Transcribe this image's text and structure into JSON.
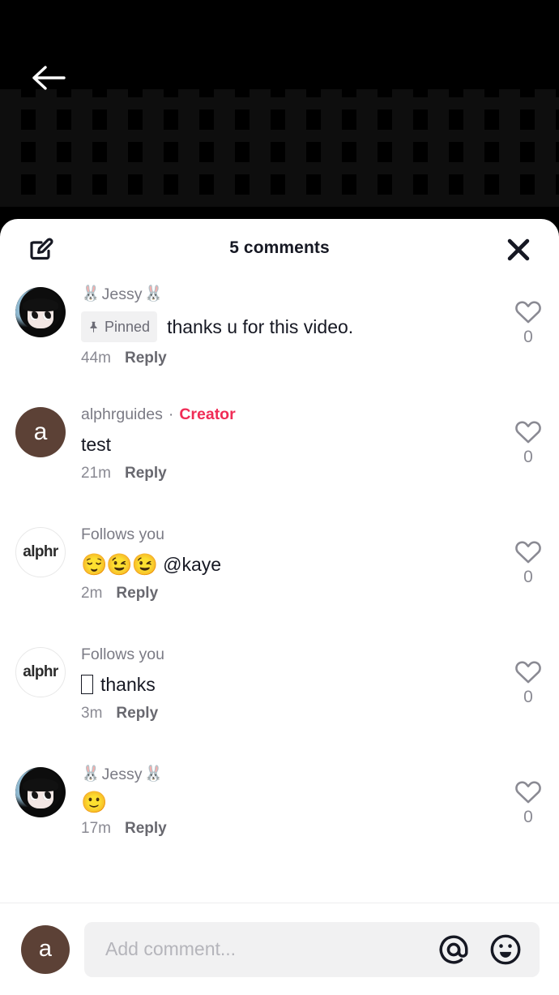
{
  "video": {
    "back_icon": "back-arrow-icon"
  },
  "header": {
    "title": "5 comments",
    "compose_icon": "compose-icon",
    "close_icon": "close-icon"
  },
  "comments": [
    {
      "avatar_type": "anime",
      "avatar_label": "",
      "name_prefix_emoji": "🐰",
      "name": "Jessy",
      "name_suffix_emoji": "🐰",
      "badge": "",
      "pinned_label": "Pinned",
      "is_pinned": true,
      "text": "thanks u for this video.",
      "emoji_prefix": "",
      "has_tofu": false,
      "time": "44m",
      "reply_label": "Reply",
      "likes": "0"
    },
    {
      "avatar_type": "brown",
      "avatar_label": "a",
      "name_prefix_emoji": "",
      "name": "alphrguides",
      "name_suffix_emoji": "",
      "badge": "Creator",
      "pinned_label": "",
      "is_pinned": false,
      "text": "test",
      "emoji_prefix": "",
      "has_tofu": false,
      "time": "21m",
      "reply_label": "Reply",
      "likes": "0"
    },
    {
      "avatar_type": "logo",
      "avatar_label": "alphr",
      "name_prefix_emoji": "",
      "name": "Follows you",
      "name_suffix_emoji": "",
      "badge": "",
      "pinned_label": "",
      "is_pinned": false,
      "text": "@kaye",
      "emoji_prefix": "😌😉😉",
      "has_tofu": false,
      "time": "2m",
      "reply_label": "Reply",
      "likes": "0"
    },
    {
      "avatar_type": "logo",
      "avatar_label": "alphr",
      "name_prefix_emoji": "",
      "name": "Follows you",
      "name_suffix_emoji": "",
      "badge": "",
      "pinned_label": "",
      "is_pinned": false,
      "text": "thanks",
      "emoji_prefix": "",
      "has_tofu": true,
      "time": "3m",
      "reply_label": "Reply",
      "likes": "0"
    },
    {
      "avatar_type": "anime",
      "avatar_label": "",
      "name_prefix_emoji": "🐰",
      "name": "Jessy",
      "name_suffix_emoji": "🐰",
      "badge": "",
      "pinned_label": "",
      "is_pinned": false,
      "text": "",
      "emoji_prefix": "🙂",
      "has_tofu": false,
      "time": "17m",
      "reply_label": "Reply",
      "likes": "0"
    }
  ],
  "composer": {
    "avatar_label": "a",
    "placeholder": "Add comment...",
    "mention_icon": "at-mention-icon",
    "emoji_icon": "emoji-picker-icon"
  },
  "colors": {
    "creator_pink": "#f02c56",
    "avatar_brown": "#5c4136",
    "text_primary": "#161823",
    "text_muted": "#8a8a93",
    "pill_bg": "#f1f1f2"
  }
}
